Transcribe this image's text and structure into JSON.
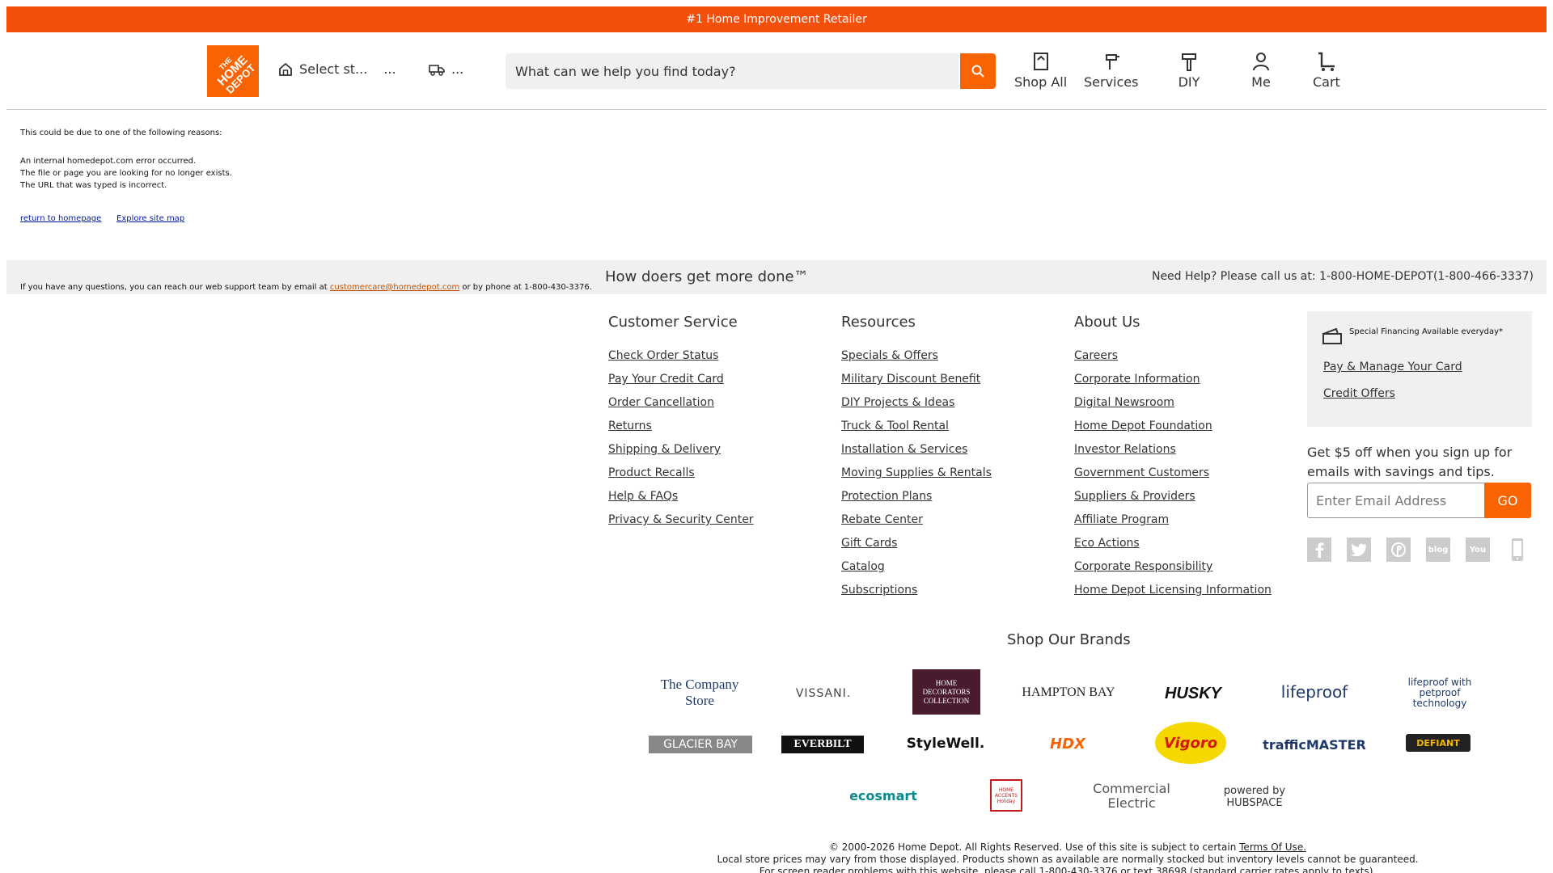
{
  "topbar": {
    "text": "#1 Home Improvement Retailer"
  },
  "header": {
    "store_label": "Select st...",
    "store_dots": "...",
    "delivery_dots": "...",
    "search_placeholder": "What can we help you find today?",
    "nav": [
      "Shop All",
      "Services",
      "DIY",
      "Me",
      "Cart"
    ]
  },
  "error": {
    "intro": "This could be due to one of the following reasons:",
    "reasons": [
      "An internal homedepot.com error occurred.",
      "The file or page you are looking for no longer exists.",
      "The URL that was typed is incorrect."
    ],
    "links": [
      "return to homepage",
      "Explore site map"
    ]
  },
  "help": {
    "tagline": "How doers get more done™",
    "call_us": "Need Help? Please call us at: 1-800-HOME-DEPOT(1-800-466-3337)",
    "support_prefix": "If you have any questions, you can reach our web support team by email at",
    "support_email": "customercare@homedepot.com",
    "support_suffix": "or by phone at 1-800-430-3376."
  },
  "columns": [
    {
      "title": "Customer Service",
      "items": [
        "Check Order Status",
        "Pay Your Credit Card",
        "Order Cancellation",
        "Returns",
        "Shipping & Delivery",
        "Product Recalls",
        "Help & FAQs",
        "Privacy & Security Center"
      ]
    },
    {
      "title": "Resources",
      "items": [
        "Specials & Offers",
        "Military Discount Benefit",
        "DIY Projects & Ideas",
        "Truck & Tool Rental",
        "Installation & Services",
        "Moving Supplies & Rentals",
        "Protection Plans",
        "Rebate Center",
        "Gift Cards",
        "Catalog",
        "Subscriptions"
      ]
    },
    {
      "title": "About Us",
      "items": [
        "Careers",
        "Corporate Information",
        "Digital Newsroom",
        "Home Depot Foundation",
        "Investor Relations",
        "Government Customers",
        "Suppliers & Providers",
        "Affiliate Program",
        "Eco Actions",
        "Corporate Responsibility",
        "Home Depot Licensing Information"
      ]
    }
  ],
  "financing": {
    "title": "Special Financing Available everyday*",
    "links": [
      "Pay & Manage Your Card",
      "Credit Offers"
    ]
  },
  "email_signup": {
    "text": "Get $5 off when you sign up for emails with savings and tips.",
    "placeholder": "Enter Email Address",
    "button": "GO"
  },
  "social": {
    "blog": "blog",
    "youtube": "You"
  },
  "brands": {
    "title": "Shop Our Brands",
    "row1": [
      "The Company Store",
      "VISSANI.",
      "HOME DECORATORS COLLECTION",
      "HAMPTON BAY",
      "HUSKY",
      "lifeproof",
      "lifeproof with petproof technology"
    ],
    "row2": [
      "GLACIER BAY",
      "EVERBILT",
      "StyleWell.",
      "HDX",
      "Vigoro",
      "trafficMASTER",
      "DEFIANT"
    ],
    "row3": [
      "ecosmart",
      "HOME ACCENTS Holiday",
      "Commercial Electric",
      "powered by HUBSPACE"
    ]
  },
  "footer": {
    "line1_prefix": "© 2000-2026 Home Depot. All Rights Reserved. Use of this site is subject to certain",
    "line1_link": "Terms Of Use.",
    "line2": "Local store prices may vary from those displayed. Products shown as available are normally stocked but inventory levels cannot be guaranteed.",
    "line3": "For screen reader problems with this website, please call 1-800-430-3376 or text 38698 (standard carrier rates apply to texts)."
  }
}
